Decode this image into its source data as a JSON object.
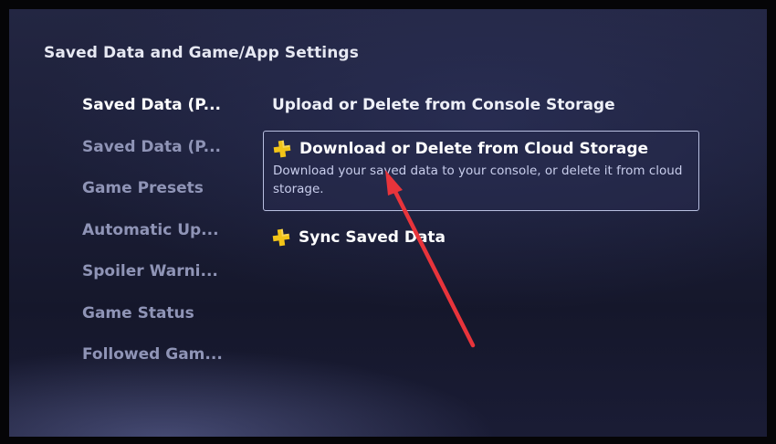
{
  "header": {
    "title": "Saved Data and Game/App Settings"
  },
  "sidebar": {
    "items": [
      {
        "label": "Saved Data (P...",
        "active": true
      },
      {
        "label": "Saved Data (P...",
        "active": false
      },
      {
        "label": "Game Presets",
        "active": false
      },
      {
        "label": "Automatic Up...",
        "active": false
      },
      {
        "label": "Spoiler Warni...",
        "active": false
      },
      {
        "label": "Game Status",
        "active": false
      },
      {
        "label": "Followed Gam...",
        "active": false
      }
    ]
  },
  "content": {
    "upload_label": "Upload or Delete from Console Storage",
    "download": {
      "label": "Download or Delete from Cloud Storage",
      "description": "Download your saved data to your console, or delete it from cloud storage.",
      "icon": "ps-plus-icon"
    },
    "sync": {
      "label": "Sync Saved Data",
      "icon": "ps-plus-icon"
    }
  },
  "annotation": {
    "arrow_color": "#e8343b",
    "icon": "red-arrow-annotation"
  },
  "colors": {
    "ps_plus_yellow": "#f2c418",
    "selection_border": "#b8bfe0"
  }
}
